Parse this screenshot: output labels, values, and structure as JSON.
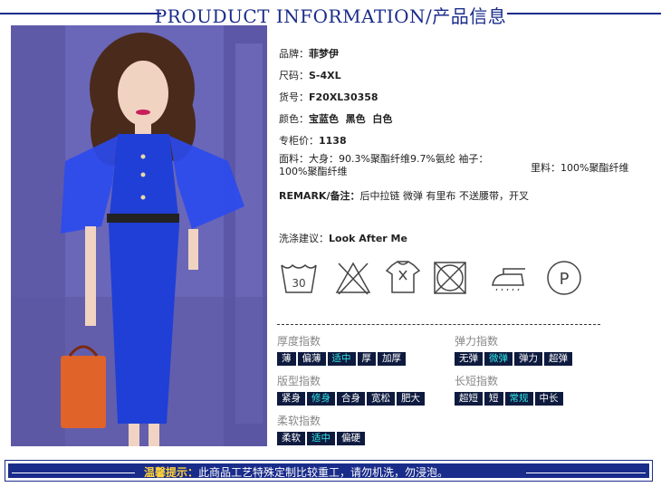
{
  "header": {
    "title": "PROUDUCT INFORMATION/产品信息"
  },
  "product": {
    "brand_label": "品牌：",
    "brand": "菲梦伊",
    "size_label": "尺码：",
    "size": "S-4XL",
    "sku_label": "货号：",
    "sku": "F20XL30358",
    "color_label": "颜色：",
    "colors": "宝蓝色  黑色  白色",
    "price_label": "专柜价：",
    "price": "1138",
    "fabric_label": "面料：",
    "fabric": "大身：90.3%聚酯纤维9.7%氨纶 袖子：100%聚酯纤维",
    "lining_label": "里料：",
    "lining": "100%聚酯纤维",
    "remark_label": "REMARK/备注：",
    "remark": "后中拉链 微弹 有里布 不送腰带，开叉",
    "wash_label": "洗涤建议：",
    "wash": "Look After Me"
  },
  "care_icons": [
    "wash-30-icon",
    "no-bleach-icon",
    "no-tumble-dry-icon",
    "no-dryclean-icon",
    "iron-icon",
    "dry-clean-p-icon"
  ],
  "care_wash_temp": "30",
  "care_p_letter": "P",
  "indices": {
    "thickness": {
      "title": "厚度指数",
      "options": [
        "薄",
        "偏薄",
        "适中",
        "厚",
        "加厚"
      ],
      "selected": 2
    },
    "elasticity": {
      "title": "弹力指数",
      "options": [
        "无弹",
        "微弹",
        "弹力",
        "超弹"
      ],
      "selected": 1
    },
    "fit": {
      "title": "版型指数",
      "options": [
        "紧身",
        "修身",
        "合身",
        "宽松",
        "肥大"
      ],
      "selected": 1
    },
    "length": {
      "title": "长短指数",
      "options": [
        "超短",
        "短",
        "常规",
        "中长"
      ],
      "selected": 2
    },
    "softness": {
      "title": "柔软指数",
      "options": [
        "柔软",
        "适中",
        "偏硬"
      ],
      "selected": 1
    }
  },
  "footer": {
    "tip_label": "温馨提示：",
    "tip": "此商品工艺特殊定制比较重工，请勿机洗，勿浸泡。"
  },
  "colors": {
    "navy": "#1a2c8a",
    "chip_bg": "#0e1a3e",
    "chip_on": "#2ee6e6",
    "dress_blue": "#1f3fd6",
    "bg_purple": "#6a66b8"
  }
}
